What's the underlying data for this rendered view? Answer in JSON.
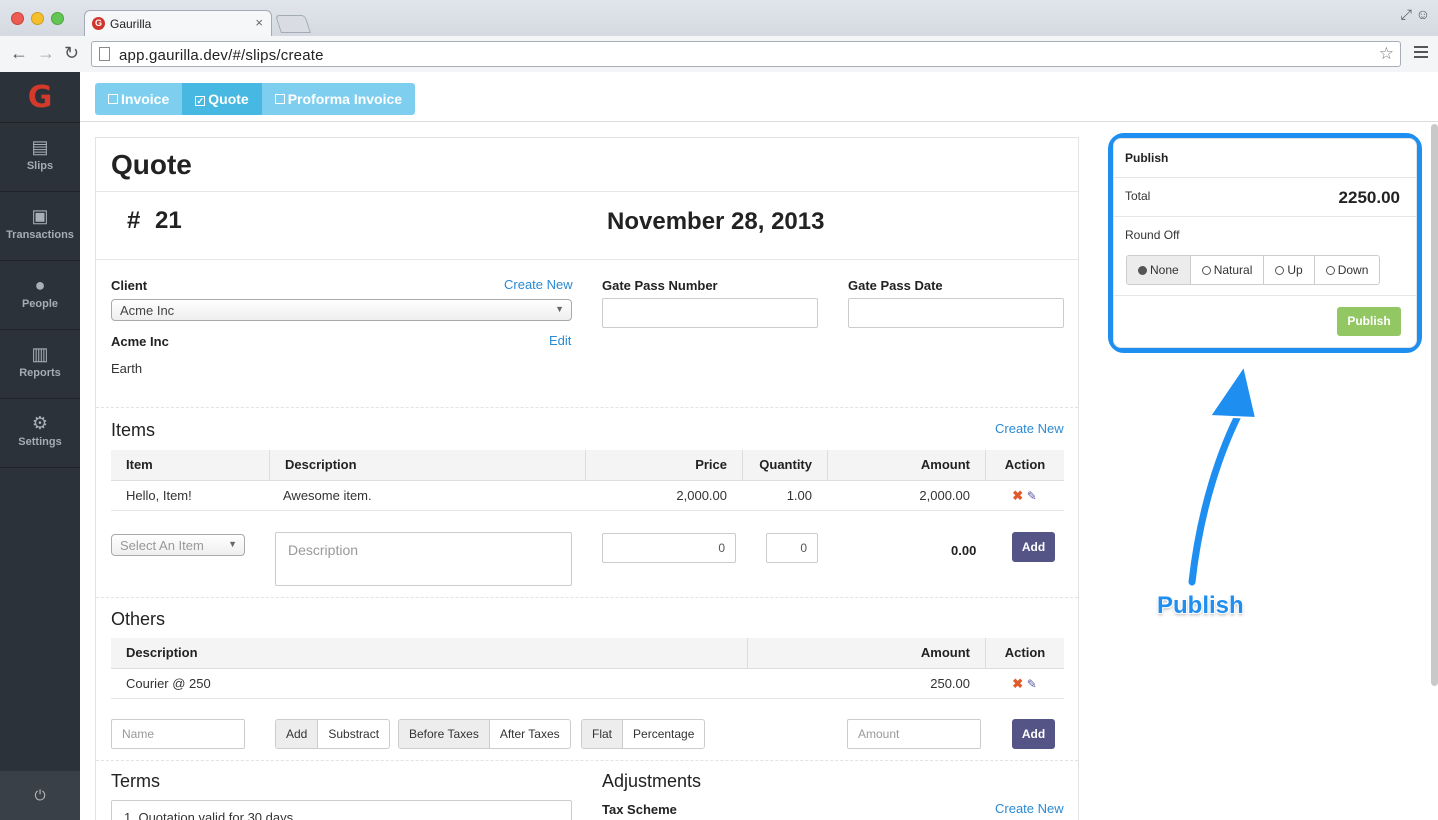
{
  "browser": {
    "tab_title": "Gaurilla",
    "tab_icon": "G",
    "url": "app.gaurilla.dev/#/slips/create"
  },
  "sidebar": {
    "logo": "G",
    "items": [
      {
        "label": "Slips",
        "icon": "document-icon"
      },
      {
        "label": "Transactions",
        "icon": "money-icon"
      },
      {
        "label": "People",
        "icon": "person-icon"
      },
      {
        "label": "Reports",
        "icon": "report-icon"
      },
      {
        "label": "Settings",
        "icon": "gear-icon"
      }
    ],
    "power_glyph": "⏻"
  },
  "slip_types": [
    {
      "label": "Invoice",
      "checked": false
    },
    {
      "label": "Quote",
      "checked": true
    },
    {
      "label": "Proforma Invoice",
      "checked": false
    }
  ],
  "doc": {
    "title": "Quote",
    "number": "# 21",
    "date": "November 28, 2013"
  },
  "client": {
    "label": "Client",
    "create_new": "Create New",
    "selected": "Acme Inc",
    "name": "Acme Inc",
    "edit": "Edit",
    "address": "Earth"
  },
  "gate_pass": {
    "number_label": "Gate Pass Number",
    "date_label": "Gate Pass Date"
  },
  "items": {
    "title": "Items",
    "create_new": "Create New",
    "headers": [
      "Item",
      "Description",
      "Price",
      "Quantity",
      "Amount",
      "Action"
    ],
    "rows": [
      {
        "item": "Hello, Item!",
        "description": "Awesome item.",
        "price": "2,000.00",
        "quantity": "1.00",
        "amount": "2,000.00"
      }
    ],
    "new": {
      "select_placeholder": "Select An Item",
      "description_placeholder": "Description",
      "price": "0",
      "quantity": "0",
      "amount": "0.00",
      "add_label": "Add"
    }
  },
  "others": {
    "title": "Others",
    "headers": [
      "Description",
      "Amount",
      "Action"
    ],
    "rows": [
      {
        "description": "Courier @ 250",
        "amount": "250.00"
      }
    ],
    "new": {
      "name_placeholder": "Name",
      "op_options": [
        "Add",
        "Substract"
      ],
      "tax_options": [
        "Before Taxes",
        "After Taxes"
      ],
      "mode_options": [
        "Flat",
        "Percentage"
      ],
      "amount_placeholder": "Amount",
      "add_label": "Add"
    }
  },
  "terms": {
    "title": "Terms",
    "text": "1. Quotation valid for 30 days"
  },
  "adjustments": {
    "title": "Adjustments",
    "tax_scheme_label": "Tax Scheme",
    "create_new": "Create New"
  },
  "publish": {
    "title": "Publish",
    "total_label": "Total",
    "total_value": "2250.00",
    "round_off_label": "Round Off",
    "round_options": [
      "None",
      "Natural",
      "Up",
      "Down"
    ],
    "round_selected": "None",
    "button_label": "Publish"
  },
  "annotation": {
    "label": "Publish",
    "color": "#1f8ef1"
  }
}
